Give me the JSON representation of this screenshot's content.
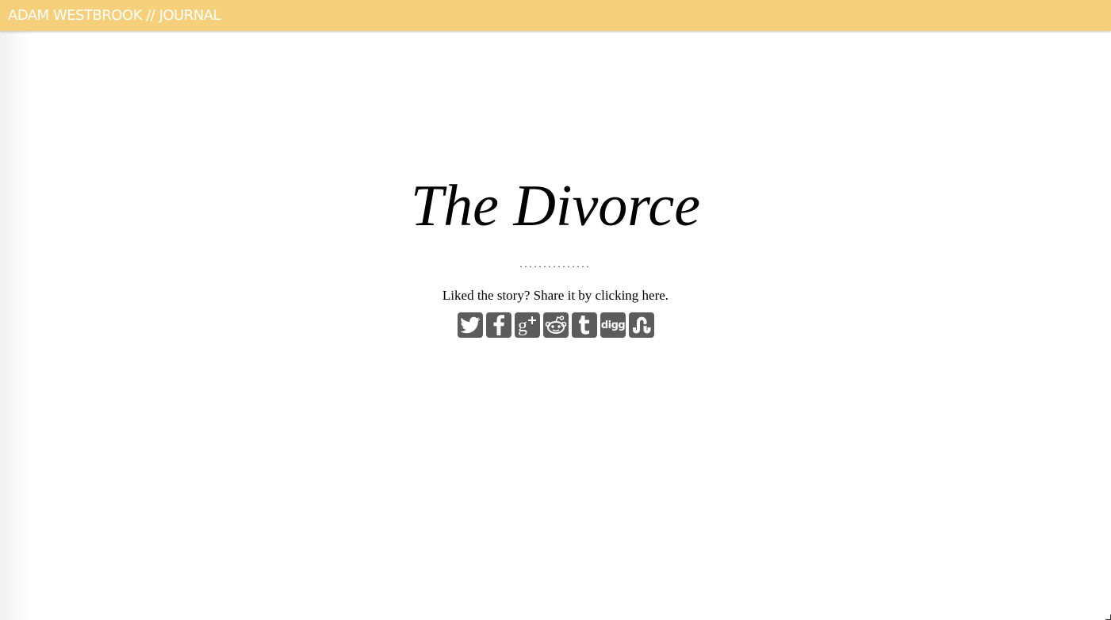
{
  "header": {
    "brand": "ADAM WESTBROOK // JOURNAL",
    "background_color": "#f5cf7a"
  },
  "article": {
    "title": "The Divorce",
    "divider": "...............",
    "share_prefix": "Liked the story? Share it by ",
    "share_link": "clicking here."
  },
  "share": {
    "icons": [
      {
        "name": "twitter-icon"
      },
      {
        "name": "facebook-icon"
      },
      {
        "name": "google-plus-icon"
      },
      {
        "name": "reddit-icon"
      },
      {
        "name": "tumblr-icon",
        "glyph": "t"
      },
      {
        "name": "digg-icon",
        "glyph": "digg"
      },
      {
        "name": "stumbleupon-icon"
      }
    ],
    "icon_color": "#5c5c5c"
  }
}
